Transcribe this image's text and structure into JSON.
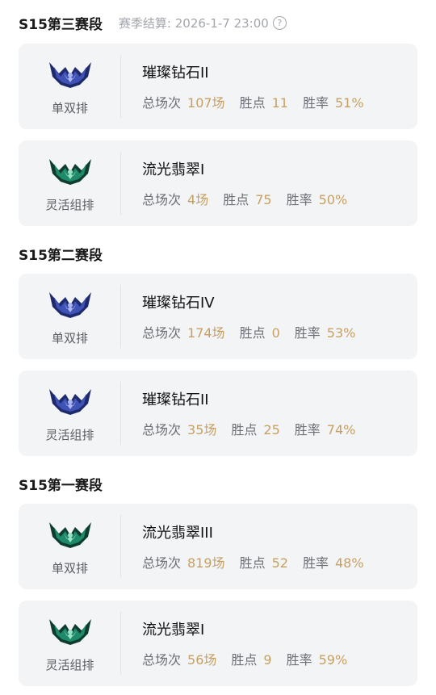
{
  "stat_labels": {
    "games": "总场次",
    "points": "胜点",
    "winrate": "胜率"
  },
  "seasons": [
    {
      "title": "S15第三赛段",
      "meta": "赛季结算: 2026-1-7 23:00",
      "cards": [
        {
          "queue": "单双排",
          "emblem": "diamond-emblem-icon",
          "rank": "璀璨钻石II",
          "games": "107场",
          "points": "11",
          "winrate": "51%"
        },
        {
          "queue": "灵活组排",
          "emblem": "emerald-emblem-icon",
          "rank": "流光翡翠I",
          "games": "4场",
          "points": "75",
          "winrate": "50%"
        }
      ]
    },
    {
      "title": "S15第二赛段",
      "cards": [
        {
          "queue": "单双排",
          "emblem": "diamond-emblem-icon",
          "rank": "璀璨钻石IV",
          "games": "174场",
          "points": "0",
          "winrate": "53%"
        },
        {
          "queue": "灵活组排",
          "emblem": "diamond-emblem-icon",
          "rank": "璀璨钻石II",
          "games": "35场",
          "points": "25",
          "winrate": "74%"
        }
      ]
    },
    {
      "title": "S15第一赛段",
      "cards": [
        {
          "queue": "单双排",
          "emblem": "emerald-emblem-icon",
          "rank": "流光翡翠III",
          "games": "819场",
          "points": "52",
          "winrate": "48%"
        },
        {
          "queue": "灵活组排",
          "emblem": "emerald-emblem-icon",
          "rank": "流光翡翠I",
          "games": "56场",
          "points": "9",
          "winrate": "59%"
        }
      ]
    }
  ],
  "colors": {
    "diamond": "#3f52b5",
    "emerald": "#1f8a6a",
    "value": "#c6a063"
  }
}
